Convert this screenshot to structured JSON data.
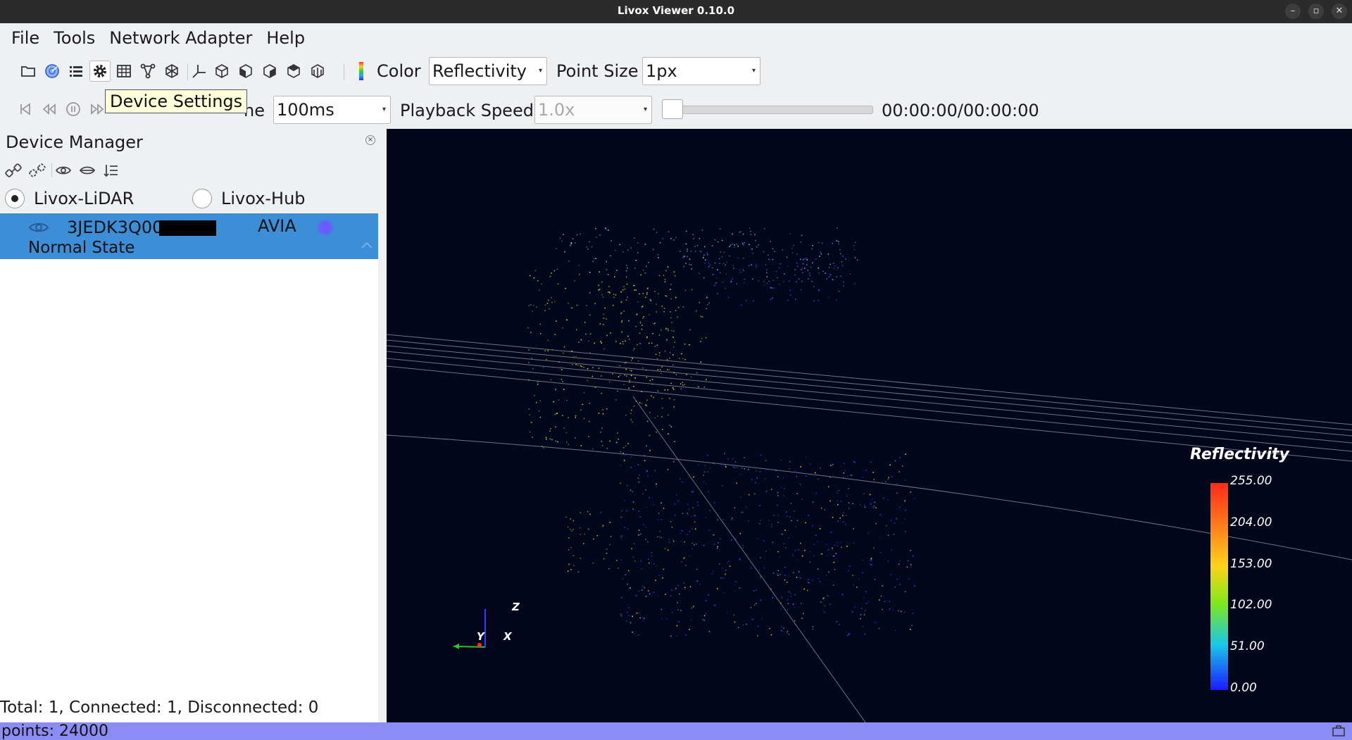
{
  "window": {
    "title": "Livox Viewer 0.10.0",
    "controls": [
      "minimize-icon",
      "restore-icon",
      "close-icon"
    ]
  },
  "menu": [
    "File",
    "Tools",
    "Network Adapter",
    "Help"
  ],
  "toolbar": {
    "icons": [
      "open-folder-icon",
      "radar-icon",
      "list-icon",
      "gear-icon",
      "table-icon",
      "network-icon",
      "cube-outline-icon",
      "axis-icon",
      "cube-front-icon",
      "cube-side-icon",
      "cube-right-icon",
      "cube-top-icon",
      "cube-iso-icon"
    ],
    "color_label": "Color",
    "color_value": "Reflectivity",
    "point_size_label": "Point Size",
    "point_size_value": "1px"
  },
  "tooltip": "Device Settings",
  "playback": {
    "frame_time_label_partial": "ne",
    "frame_time_value": "100ms",
    "speed_label": "Playback Speed",
    "speed_value": "1.0x",
    "progress": 0,
    "time": "00:00:00/00:00:00"
  },
  "device_manager": {
    "title": "Device Manager",
    "modes": [
      {
        "label": "Livox-LiDAR",
        "checked": true
      },
      {
        "label": "Livox-Hub",
        "checked": false
      }
    ],
    "device": {
      "sn": "3JEDK3Q00",
      "model": "AVIA",
      "state": "Normal State"
    },
    "footer": "Total: 1, Connected: 1, Disconnected: 0"
  },
  "legend": {
    "title": "Reflectivity",
    "ticks": [
      "255.00",
      "204.00",
      "153.00",
      "102.00",
      "51.00",
      "0.00"
    ],
    "colors": [
      "#ff2a1a",
      "#ff7a1a",
      "#ffd21a",
      "#7fe81a",
      "#1ac8e8",
      "#1a1aff"
    ]
  },
  "axes": {
    "z": "Z",
    "y": "Y",
    "x": "X"
  },
  "status": {
    "points": "points: 24000"
  }
}
